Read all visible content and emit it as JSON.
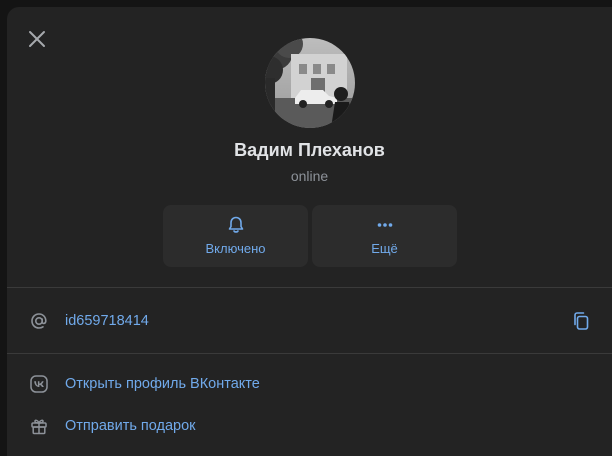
{
  "profile": {
    "name": "Вадим Плеханов",
    "status": "online"
  },
  "actions": [
    {
      "label": "Включено",
      "icon": "bell-icon"
    },
    {
      "label": "Ещё",
      "icon": "more-dots-icon"
    }
  ],
  "info": {
    "username": "id659718414",
    "username_icon": "at-icon",
    "copy_icon": "copy-icon"
  },
  "links": [
    {
      "label": "Открыть профиль ВКонтакте",
      "icon": "vk-icon"
    },
    {
      "label": "Отправить подарок",
      "icon": "gift-icon"
    }
  ],
  "colors": {
    "accent": "#71aaeb",
    "panel": "#232323",
    "text_primary": "#e1e3e6",
    "text_secondary": "#8d9299"
  }
}
